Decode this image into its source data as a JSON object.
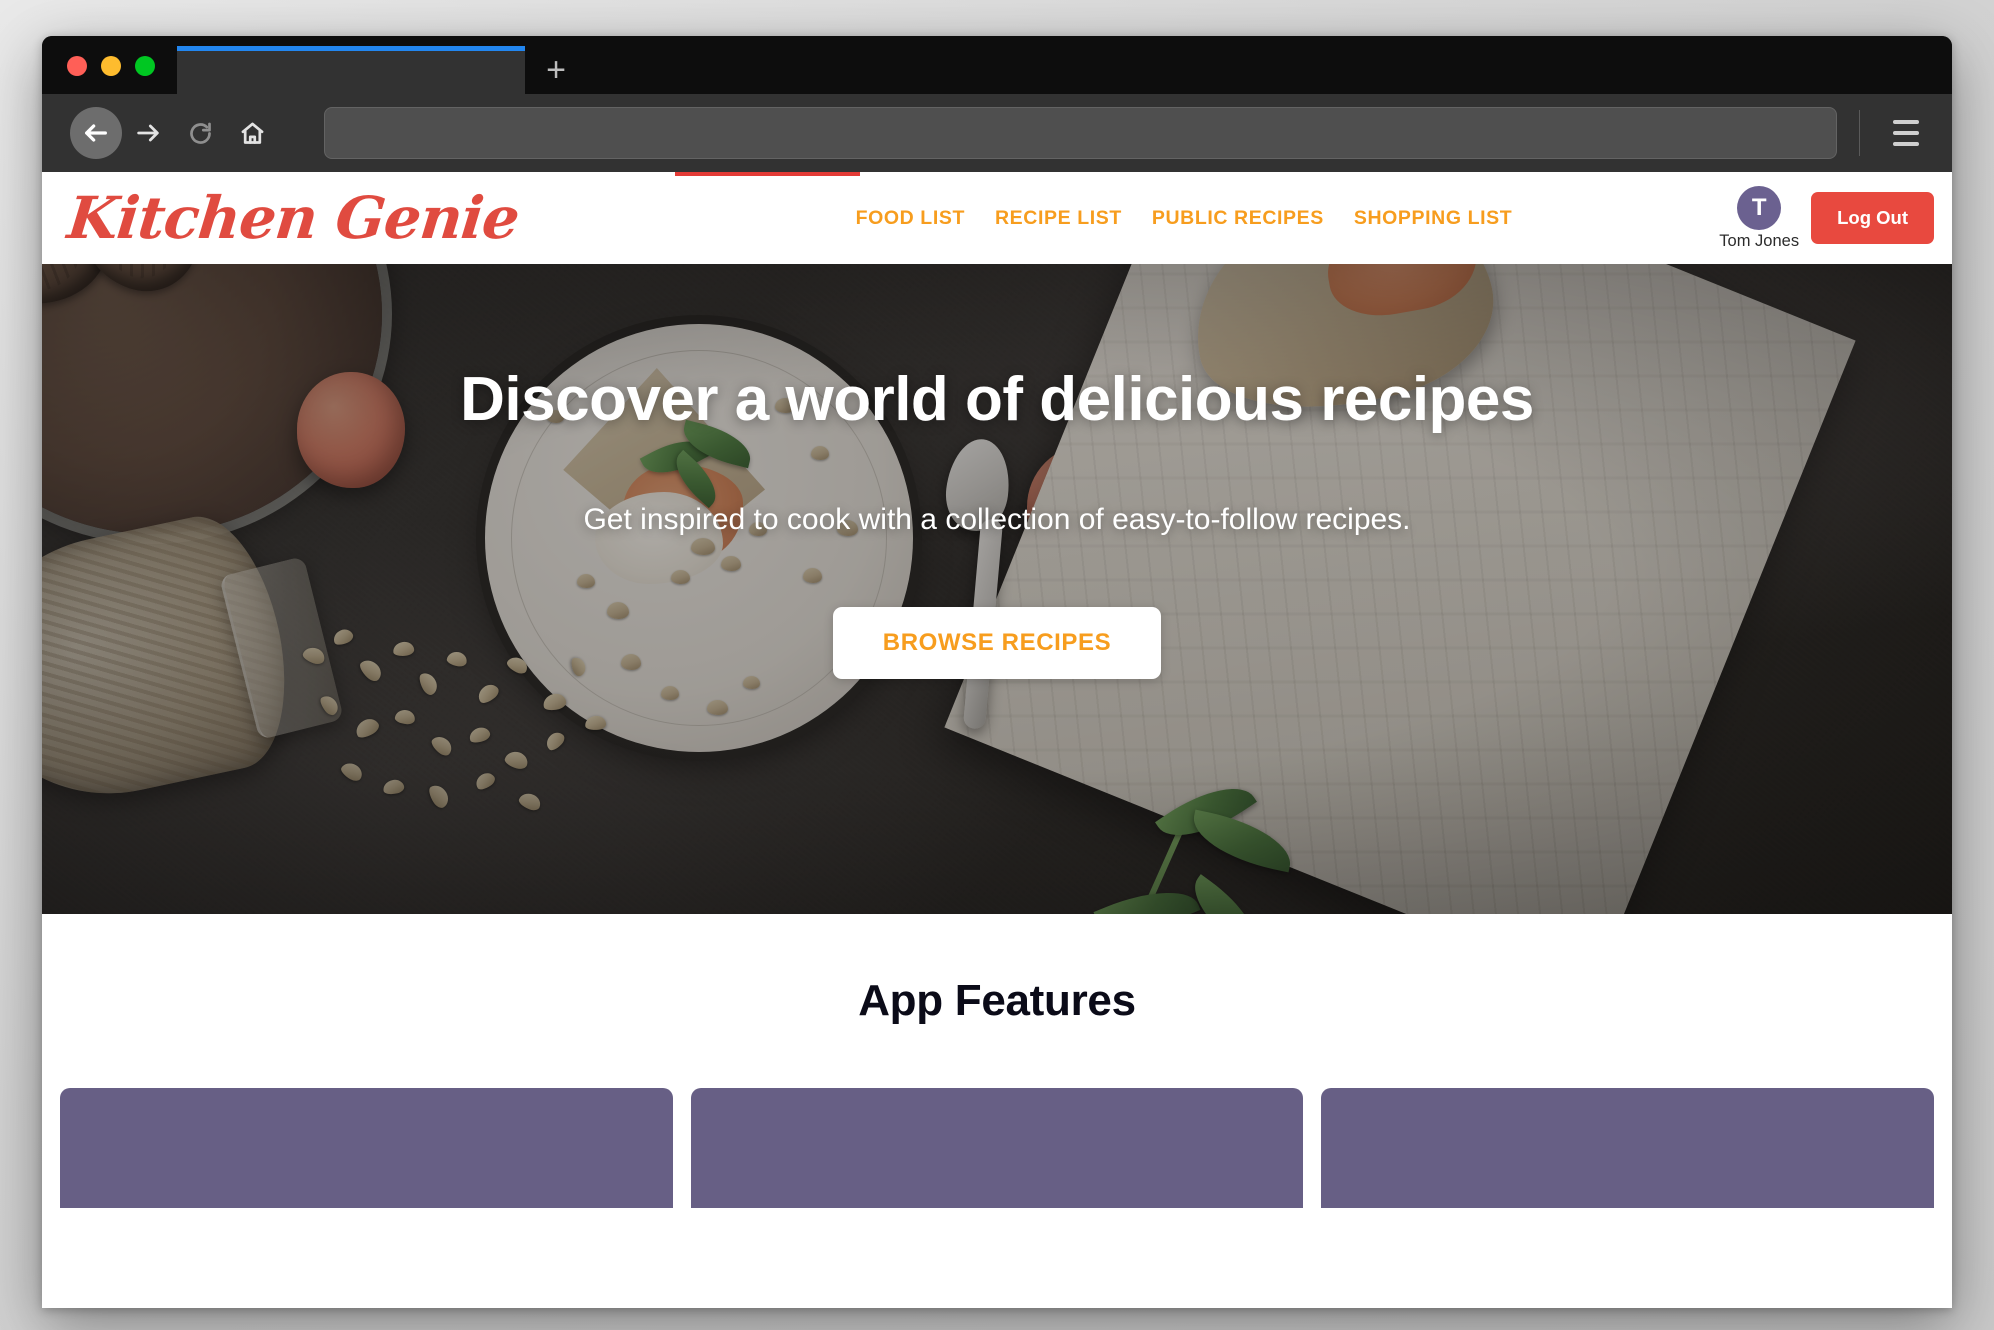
{
  "browser": {
    "traffic_lights": [
      "close",
      "minimize",
      "maximize"
    ],
    "tab_title": "",
    "new_tab_label": "+",
    "url_value": "",
    "url_placeholder": "",
    "back_icon": "arrow-left-icon",
    "forward_icon": "arrow-right-icon",
    "reload_icon": "reload-icon",
    "home_icon": "home-icon",
    "menu_icon": "hamburger-menu-icon",
    "accent_tab_color": "#2286ef",
    "progress_color": "#e33b36"
  },
  "site": {
    "brand": "Kitchen Genie",
    "brand_color": "#e04b40",
    "nav": [
      {
        "label": "FOOD LIST"
      },
      {
        "label": "RECIPE LIST"
      },
      {
        "label": "PUBLIC RECIPES"
      },
      {
        "label": "SHOPPING LIST"
      }
    ],
    "nav_color": "#f79d1e",
    "user": {
      "initial": "T",
      "name": "Tom Jones",
      "avatar_color": "#6b6190"
    },
    "logout_label": "Log Out",
    "logout_color": "#e8493f"
  },
  "hero": {
    "title": "Discover a world of delicious recipes",
    "subtitle": "Get inspired to cook with a collection of easy-to-follow recipes.",
    "cta_label": "BROWSE RECIPES",
    "cta_text_color": "#f79d1e"
  },
  "features": {
    "title": "App Features",
    "card_color": "#675f85",
    "cards": [
      {
        "id": "feature-card-1"
      },
      {
        "id": "feature-card-2"
      },
      {
        "id": "feature-card-3"
      }
    ]
  }
}
